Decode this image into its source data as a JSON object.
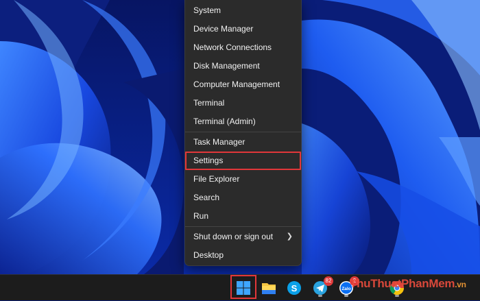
{
  "context_menu": {
    "items": [
      {
        "label": "System"
      },
      {
        "label": "Device Manager"
      },
      {
        "label": "Network Connections"
      },
      {
        "label": "Disk Management"
      },
      {
        "label": "Computer Management"
      },
      {
        "label": "Terminal"
      },
      {
        "label": "Terminal (Admin)"
      },
      {
        "label": "Task Manager"
      },
      {
        "label": "Settings",
        "highlighted": true
      },
      {
        "label": "File Explorer"
      },
      {
        "label": "Search"
      },
      {
        "label": "Run"
      },
      {
        "label": "Shut down or sign out",
        "has_submenu": true
      },
      {
        "label": "Desktop"
      }
    ],
    "submenu_icon": "chevron-right-icon",
    "highlight_color": "#e2373a"
  },
  "taskbar": {
    "icons": [
      {
        "name": "windows-start-icon",
        "highlighted": true
      },
      {
        "name": "file-explorer-icon"
      },
      {
        "name": "skype-icon",
        "letter": "S"
      },
      {
        "name": "telegram-icon",
        "badge": "82"
      },
      {
        "name": "zalo-icon",
        "badge": "2",
        "label": "Zalo"
      },
      {
        "name": "chrome-icon"
      }
    ]
  },
  "watermark": {
    "main": "ThuThuatPhanMem",
    "suffix": ".vn"
  },
  "colors": {
    "desktop_background": "#0b1e6e",
    "menu_background": "#2b2b2b",
    "taskbar_background": "#1c1c1c",
    "accent_blue": "#1a66ff"
  }
}
